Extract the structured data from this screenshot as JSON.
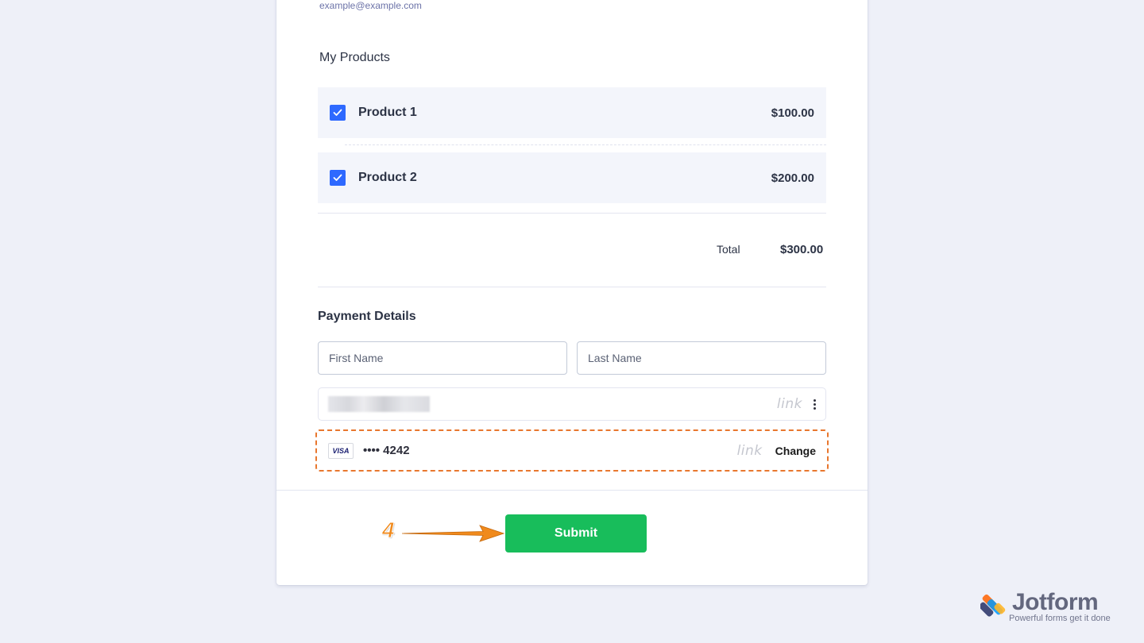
{
  "form": {
    "email_sublabel": "example@example.com",
    "products_label": "My Products",
    "products": [
      {
        "name": "Product 1",
        "price": "$100.00",
        "checked": true
      },
      {
        "name": "Product 2",
        "price": "$200.00",
        "checked": true
      }
    ],
    "total_label": "Total",
    "total_value": "$300.00",
    "payment_title": "Payment Details",
    "first_name_placeholder": "First Name",
    "last_name_placeholder": "Last Name",
    "link_logo": "link",
    "card_brand": "VISA",
    "card_number": "•••• 4242",
    "change_label": "Change",
    "submit_label": "Submit"
  },
  "annotation": {
    "step_number": "4",
    "color": "#f08a1c"
  },
  "branding": {
    "name": "Jotform",
    "tagline": "Powerful forms get it done"
  },
  "colors": {
    "accent_blue": "#2e69ff",
    "submit_green": "#18bd5b",
    "highlight_orange": "#e8772e",
    "background": "#eef0f8"
  }
}
